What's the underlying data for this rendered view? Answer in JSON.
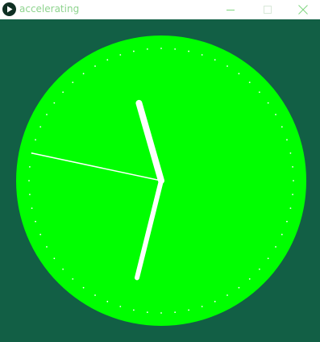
{
  "window": {
    "title": "accelerating",
    "controls": {
      "minimize_icon": "minimize-icon",
      "maximize_icon": "maximize-icon",
      "close_icon": "close-icon"
    }
  },
  "clock": {
    "face_color": "#00ff00",
    "background_color": "#125f45",
    "hand_color": "#ffffff",
    "tick_count": 60,
    "hands": {
      "hour": {
        "angle_deg": -16
      },
      "minute": {
        "angle_deg": 194
      },
      "second": {
        "angle_deg": -78
      }
    }
  }
}
